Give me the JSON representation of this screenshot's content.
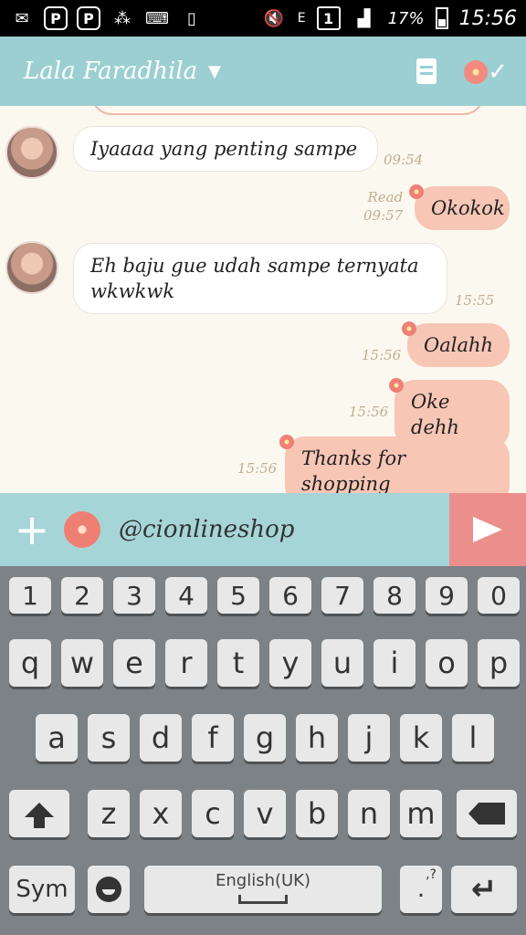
{
  "status_bar": {
    "left_icons": [
      "mail-icon",
      "p-app-icon",
      "p-app-icon",
      "bbm-icon",
      "keyboard-icon",
      "screen-timer-icon"
    ],
    "network_indicator": "1",
    "signal_label": "E",
    "battery_percent": "17%",
    "time": "15:56"
  },
  "header": {
    "contact_name": "Lala Faradhila",
    "colors": {
      "header_bg": "#9ccfd2",
      "send_bg": "#ec8f8c"
    }
  },
  "messages": [
    {
      "dir": "in",
      "text": "Iyaaaa yang penting sampe",
      "time": "09:54"
    },
    {
      "dir": "out",
      "text": "Okokok",
      "read": "Read",
      "time": "09:57"
    },
    {
      "dir": "in",
      "text_line1": "Eh baju gue udah sampe ternyata",
      "text_line2": "wkwkwk",
      "time": "15:55"
    },
    {
      "dir": "out",
      "text": "Oalahh",
      "time": "15:56"
    },
    {
      "dir": "out",
      "text": "Oke dehh",
      "time": "15:56"
    },
    {
      "dir": "out",
      "text": "Thanks for shopping",
      "time": "15:56"
    }
  ],
  "input": {
    "value": "@cionlineshop"
  },
  "keyboard": {
    "numbers": [
      "1",
      "2",
      "3",
      "4",
      "5",
      "6",
      "7",
      "8",
      "9",
      "0"
    ],
    "row1": [
      "q",
      "w",
      "e",
      "r",
      "t",
      "y",
      "u",
      "i",
      "o",
      "p"
    ],
    "row2": [
      "a",
      "s",
      "d",
      "f",
      "g",
      "h",
      "j",
      "k",
      "l"
    ],
    "row3": [
      "z",
      "x",
      "c",
      "v",
      "b",
      "n",
      "m"
    ],
    "sym": "Sym",
    "space_label": "English(UK)",
    "punct_key": ".",
    "punct_hint": ",?"
  }
}
